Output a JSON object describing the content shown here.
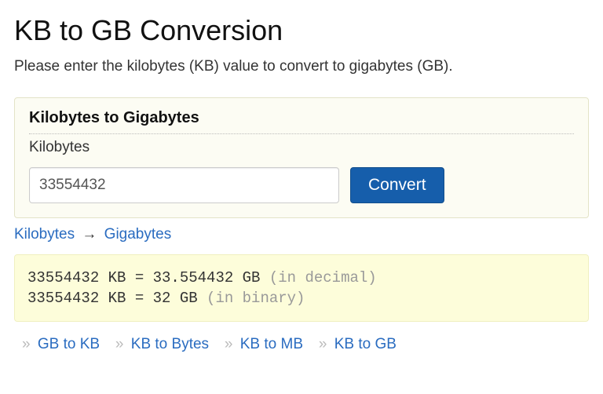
{
  "title": "KB to GB Conversion",
  "intro": "Please enter the kilobytes (KB) value to convert to gigabytes (GB).",
  "panel": {
    "heading": "Kilobytes to Gigabytes",
    "field_label": "Kilobytes",
    "input_value": "33554432",
    "button_label": "Convert"
  },
  "crumb": {
    "from": "Kilobytes",
    "arrow": "→",
    "to": "Gigabytes"
  },
  "result": {
    "line1_strong": "33554432 KB = 33.554432 GB",
    "line1_muted": " (in decimal)",
    "line2_strong": "33554432 KB = 32 GB",
    "line2_muted": " (in binary)"
  },
  "related": {
    "sep": "»",
    "links": [
      "GB to KB",
      "KB to Bytes",
      "KB to MB",
      "KB to GB"
    ]
  }
}
